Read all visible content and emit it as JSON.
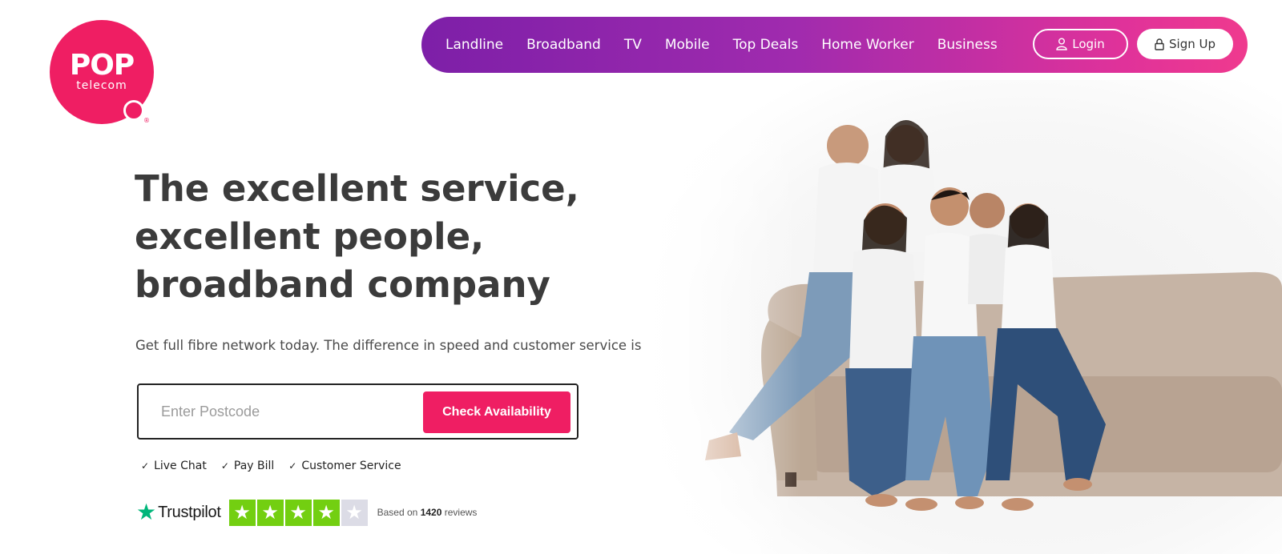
{
  "logo": {
    "name": "POP",
    "sub": "telecom",
    "reg": "®",
    "color": "#ef1e63"
  },
  "nav": {
    "items": [
      {
        "label": "Landline"
      },
      {
        "label": "Broadband"
      },
      {
        "label": "TV"
      },
      {
        "label": "Mobile"
      },
      {
        "label": "Top Deals"
      },
      {
        "label": "Home Worker"
      },
      {
        "label": "Business"
      }
    ],
    "login_label": "Login",
    "signup_label": "Sign Up",
    "login_icon": "user-icon",
    "signup_icon": "lock-icon",
    "gradient_start": "#7d1fa8",
    "gradient_end": "#ef3a8e"
  },
  "hero": {
    "headline_line1": "The excellent service,",
    "headline_line2": "excellent people,",
    "headline_line3": "broadband company",
    "subtext": "Get full fibre network today. The difference in speed and customer service is worth it",
    "image": "family-on-sofa-photo"
  },
  "postcode_form": {
    "placeholder": "Enter Postcode",
    "value": "",
    "button_label": "Check Availability",
    "button_color": "#ef1e63"
  },
  "features": [
    {
      "tick": "✓",
      "label": "Live Chat"
    },
    {
      "tick": "✓",
      "label": "Pay Bill"
    },
    {
      "tick": "✓",
      "label": "Customer Service"
    }
  ],
  "trustpilot": {
    "brand": "Trustpilot",
    "rating_stars": 4,
    "max_stars": 5,
    "based_on": "Based on",
    "review_count": "1420",
    "reviews_word": "reviews",
    "star_color": "#73cf11",
    "brand_star_color": "#00b67a"
  }
}
